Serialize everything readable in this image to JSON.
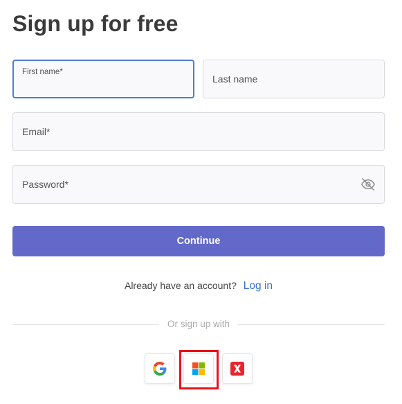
{
  "page_title": "Sign up for free",
  "fields": {
    "first_name": {
      "label": "First name*",
      "value": ""
    },
    "last_name": {
      "label": "Last name",
      "value": ""
    },
    "email": {
      "label": "Email*",
      "value": ""
    },
    "password": {
      "label": "Password*",
      "value": ""
    }
  },
  "continue_label": "Continue",
  "login": {
    "prompt": "Already have an account?",
    "link": "Log in"
  },
  "divider_text": "Or sign up with",
  "social": [
    {
      "icon": "google-icon"
    },
    {
      "icon": "microsoft-icon"
    },
    {
      "icon": "x-icon"
    }
  ],
  "colors": {
    "accent": "#6269c9",
    "focus_border": "#4b7bd6",
    "link": "#3b6fd1",
    "highlight": "#e8121a"
  }
}
